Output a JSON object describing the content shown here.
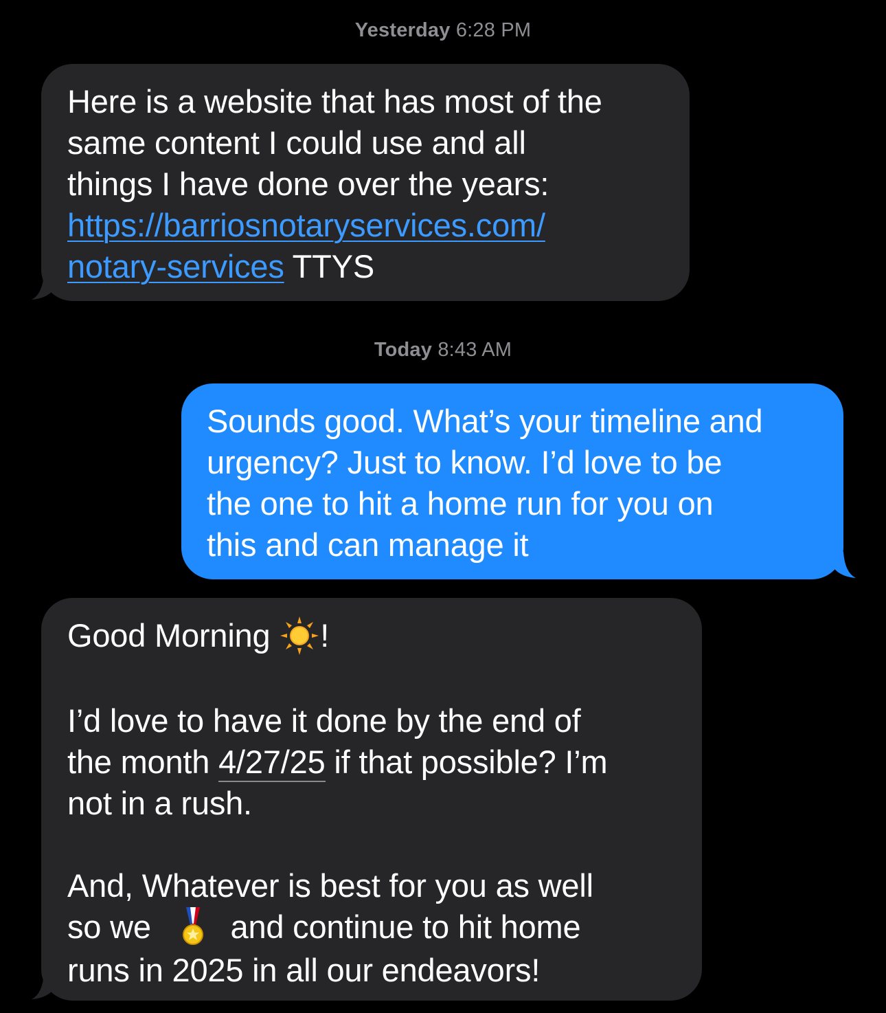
{
  "timestamps": [
    {
      "day": "Yesterday",
      "time": "6:28 PM"
    },
    {
      "day": "Today",
      "time": "8:43 AM"
    }
  ],
  "messages": [
    {
      "direction": "incoming",
      "lines": [
        "Here is a website that has most of the",
        "same content I could use  and all",
        "things I have done over the years:"
      ],
      "link_part1": "https://barriosnotaryservices.com/",
      "link_part2": "notary-services",
      "suffix": " TTYS"
    },
    {
      "direction": "outgoing",
      "lines": [
        "Sounds good. What’s your timeline and",
        "urgency? Just to know. I’d love to be",
        "the one to hit a home run for you on",
        "this and can manage it"
      ]
    },
    {
      "direction": "incoming",
      "greeting": "Good Morning ",
      "greeting_end": "!",
      "greeting_emoji": "sun-emoji",
      "para2_line1": "I’d love to have it done by the end of",
      "para2_line2_pre": "the month ",
      "date": "4/27/25",
      "para2_line2_post": " if that possible? I’m",
      "para2_line3": "not in a rush.",
      "para3_line1": "And, Whatever is best for you as well",
      "para3_line2_pre": "so we ",
      "para3_emoji": "medal-emoji",
      "para3_line2_post": " and continue to hit home",
      "para3_line3": "runs in 2025 in all our endeavors!"
    }
  ],
  "colors": {
    "background": "#000000",
    "incoming_bubble": "#262629",
    "outgoing_bubble": "#1f8bff",
    "link": "#3d9bff",
    "timestamp": "#8e8e93"
  }
}
